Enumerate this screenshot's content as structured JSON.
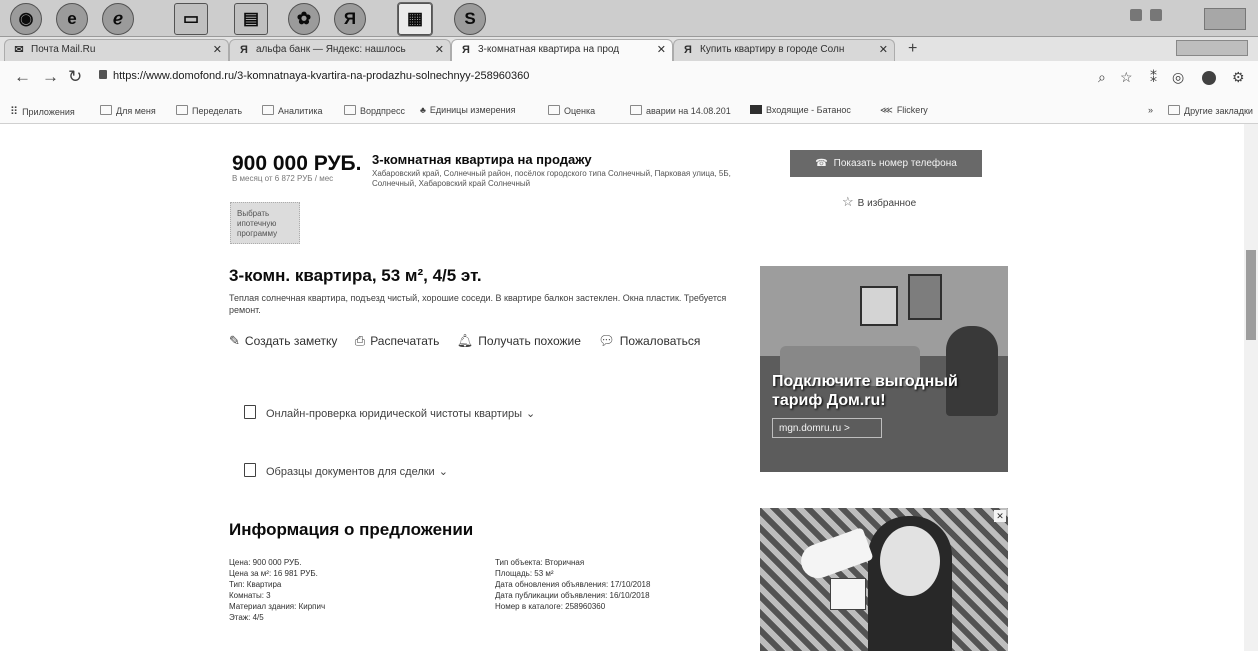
{
  "tabs": [
    {
      "label": "Почта Mail.Ru",
      "favicon": "mail-icon"
    },
    {
      "label": "альфа банк — Яндекс: нашлось",
      "favicon": "yandex-icon"
    },
    {
      "label": "3-комнатная квартира на прод",
      "favicon": "domofond-icon"
    },
    {
      "label": "Купить квартиру в городе Солн",
      "favicon": "domofond-icon"
    }
  ],
  "address_bar": {
    "url": "https://www.domofond.ru/3-komnatnaya-kvartira-na-prodazhu-solnechnyy-258960360"
  },
  "bookmarks": [
    {
      "label": "Приложения"
    },
    {
      "label": "Для меня"
    },
    {
      "label": "Переделать"
    },
    {
      "label": "Аналитика"
    },
    {
      "label": "Вордпресс"
    },
    {
      "label": "Единицы измерения"
    },
    {
      "label": "Оценка"
    },
    {
      "label": "аварии на 14.08.201"
    },
    {
      "label": "Входящие - Батанос"
    },
    {
      "label": "Flickery"
    },
    {
      "label": "Другие закладки"
    }
  ],
  "listing": {
    "price": "900 000 РУБ.",
    "monthly": "В месяц от 6 872 РУБ / мес",
    "mortgage_btn": "Выбрать ипотечную программу",
    "headline": "3-комнатная квартира на продажу",
    "address": "Хабаровский край, Солнечный район, посёлок городского типа Солнечный, Парковая улица, 5Б, Солнечный, Хабаровский край Солнечный",
    "contact_btn": "Показать номер телефона",
    "favorite": "В избранное",
    "title": "3-комн. квартира, 53 м², 4/5 эт.",
    "description": "Теплая солнечная квартира, подъезд чистый, хорошие соседи. В квартире балкон застеклен. Окна пластик. Требуется ремонт.",
    "actions": {
      "note": "Создать заметку",
      "print": "Распечатать",
      "similar": "Получать похожие",
      "complain": "Пожаловаться"
    },
    "legal_check": "Онлайн-проверка юридической чистоты квартиры",
    "doc_samples": "Образцы документов для сделки"
  },
  "info": {
    "title": "Информация о предложении",
    "left": [
      "Цена: 900 000 РУБ.",
      "Цена за м²: 16 981 РУБ.",
      "Тип: Квартира",
      "Комнаты: 3",
      "Материал здания: Кирпич",
      "Этаж: 4/5"
    ],
    "right": [
      "Тип объекта: Вторичная",
      "Площадь: 53 м²",
      "Дата обновления объявления: 17/10/2018",
      "Дата публикации объявления: 16/10/2018",
      "Номер в каталоге: 258960360"
    ]
  },
  "ad": {
    "headline": "Подключите выгодный тариф Дом.ru!",
    "link": "mgn.domru.ru >"
  }
}
